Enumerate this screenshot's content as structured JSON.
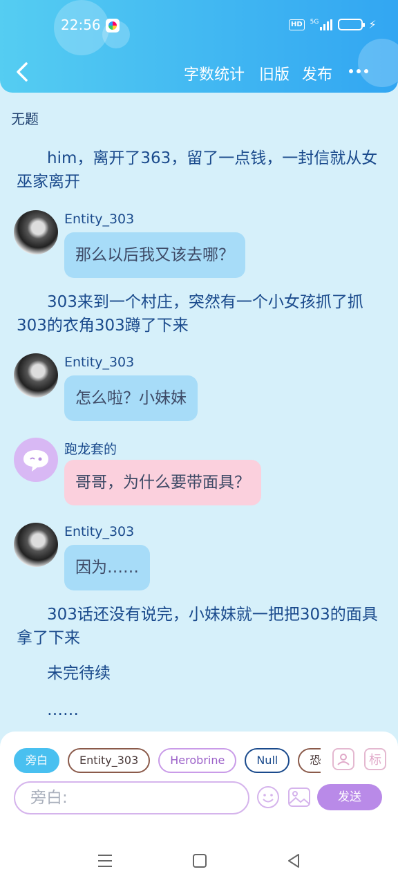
{
  "status_bar": {
    "time": "22:56",
    "hd_badge": "HD",
    "network": "5G"
  },
  "header": {
    "back_icon": "chevron-left-icon",
    "nav": [
      "字数统计",
      "旧版",
      "发布"
    ],
    "more_icon": "more-dots-icon"
  },
  "document": {
    "title": "无题",
    "paragraph_1": "him，离开了363，留了一点钱，一封信就从女巫家离开",
    "msg_1": {
      "name": "Entity_303",
      "text": "那么以后我又该去哪？"
    },
    "paragraph_2": "303来到一个村庄，突然有一个小女孩抓了抓303的衣角303蹲了下来",
    "msg_2": {
      "name": "Entity_303",
      "text": "怎么啦？小妹妹"
    },
    "msg_3": {
      "name": "跑龙套的",
      "text": "哥哥，为什么要带面具？"
    },
    "msg_4": {
      "name": "Entity_303",
      "text": "因为……"
    },
    "paragraph_3": "303话还没有说完，小妹妹就一把把303的面具拿了下来",
    "paragraph_4": "未完待续",
    "paragraph_5": "……"
  },
  "composer": {
    "roles": [
      "旁白",
      "Entity_303",
      "Herobrine",
      "Null",
      "恐惧"
    ],
    "selected_role": "旁白",
    "role_icon": "user-card-icon",
    "tag_label": "标",
    "input_placeholder": "旁白:",
    "emoji_icon": "emoji-icon",
    "image_icon": "image-icon",
    "send_label": "发送"
  },
  "navbar": {
    "icons": [
      "menu-icon",
      "home-square-icon",
      "back-triangle-icon"
    ]
  },
  "colors": {
    "header_gradient": [
      "#55cdf2",
      "#32a6f2"
    ],
    "background": "#d6f0fa",
    "bubble_blue": "#a7dcf8",
    "bubble_pink": "#fbd0dd",
    "send_button": "#b98ae8"
  }
}
